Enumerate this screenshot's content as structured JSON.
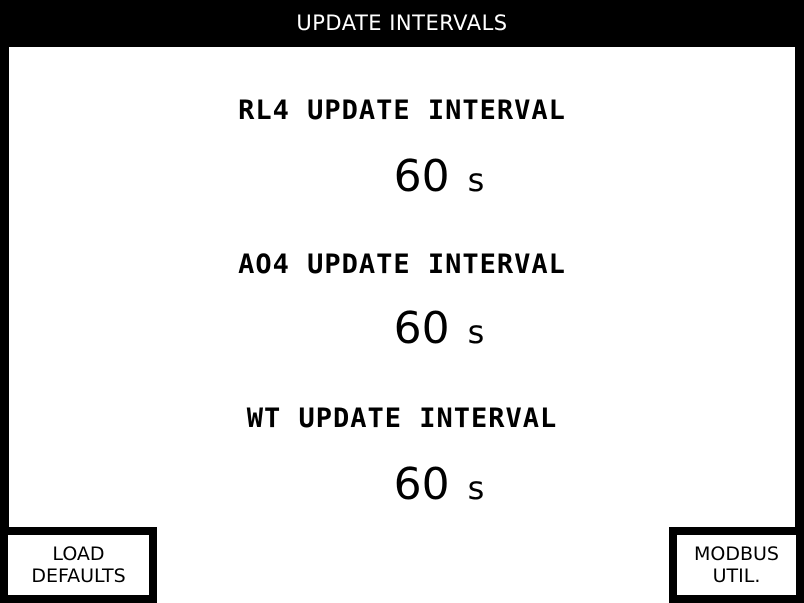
{
  "title": "UPDATE INTERVALS",
  "intervals": [
    {
      "label": "RL4 UPDATE INTERVAL",
      "value": "60",
      "unit": "s"
    },
    {
      "label": "AO4 UPDATE INTERVAL",
      "value": "60",
      "unit": "s"
    },
    {
      "label": "WT UPDATE INTERVAL",
      "value": "60",
      "unit": "s"
    }
  ],
  "buttons": {
    "load_defaults": {
      "line1": "LOAD",
      "line2": "DEFAULTS"
    },
    "modbus_util": {
      "line1": "MODBUS",
      "line2": "UTIL."
    }
  },
  "colors": {
    "background": "#000000",
    "panel": "#ffffff",
    "text": "#000000",
    "title_text": "#ffffff"
  }
}
